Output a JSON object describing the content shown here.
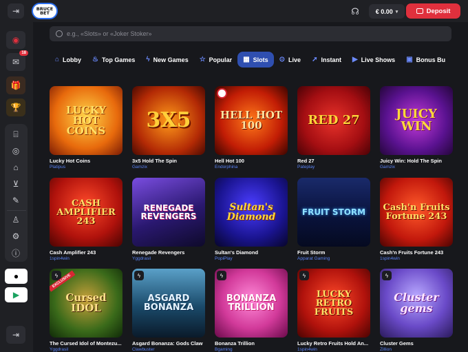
{
  "header": {
    "logo_text": "BRUCE BET",
    "balance": "€ 0.00",
    "deposit_label": "Deposit"
  },
  "sidebar": {
    "notifications_count": "18"
  },
  "search": {
    "placeholder": "e.g., «Slots» or «Joker Stoker»"
  },
  "tabs": [
    {
      "label": "Lobby",
      "icon": "home-icon"
    },
    {
      "label": "Top Games",
      "icon": "flame-icon"
    },
    {
      "label": "New Games",
      "icon": "lightning-icon"
    },
    {
      "label": "Popular",
      "icon": "star-icon"
    },
    {
      "label": "Slots",
      "icon": "slot-icon",
      "active": true
    },
    {
      "label": "Live",
      "icon": "live-icon"
    },
    {
      "label": "Instant",
      "icon": "rocket-icon"
    },
    {
      "label": "Live Shows",
      "icon": "play-icon"
    },
    {
      "label": "Bonus Bu",
      "icon": "bonus-icon"
    }
  ],
  "games": [
    {
      "name": "Lucky Hot Coins",
      "provider": "Platipus",
      "art": "LUCKY HOT COINS"
    },
    {
      "name": "3x5 Hold The Spin",
      "provider": "Gamzix",
      "art": "3X5"
    },
    {
      "name": "Hell Hot 100",
      "provider": "Endorphina",
      "art": "HELL HOT 100"
    },
    {
      "name": "Red 27",
      "provider": "Pateplay",
      "art": "RED 27"
    },
    {
      "name": "Juicy Win: Hold The Spin",
      "provider": "Gamzix",
      "art": "JUICY WIN"
    },
    {
      "name": "Cash Amplifier 243",
      "provider": "1spin4win",
      "art": "CASH AMPLIFIER 243"
    },
    {
      "name": "Renegade Revengers",
      "provider": "Yggdrasil",
      "art": "RENEGADE REVENGERS"
    },
    {
      "name": "Sultan's Diamond",
      "provider": "PopiPlay",
      "art": "Sultan's Diamond"
    },
    {
      "name": "Fruit Storm",
      "provider": "Apparat Gaming",
      "art": "FRUIT STORM"
    },
    {
      "name": "Cash'n Fruits Fortune 243",
      "provider": "1spin4win",
      "art": "Cash'n Fruits Fortune 243"
    },
    {
      "name": "The Cursed Idol of Montezu...",
      "provider": "Yggdrasil",
      "art": "Cursed IDOL",
      "exclusive": "EXCLUSIVE"
    },
    {
      "name": "Asgard Bonanza: Gods Claw",
      "provider": "Clawbuster",
      "art": "ASGARD BONANZA"
    },
    {
      "name": "Bonanza Trillion",
      "provider": "Bgaming",
      "art": "BONANZA TRILLION"
    },
    {
      "name": "Lucky Retro Fruits Hold An...",
      "provider": "1spin4win",
      "art": "LUCKY RETRO FRUITS"
    },
    {
      "name": "Cluster Gems",
      "provider": "Zillion",
      "art": "Cluster gems"
    }
  ]
}
